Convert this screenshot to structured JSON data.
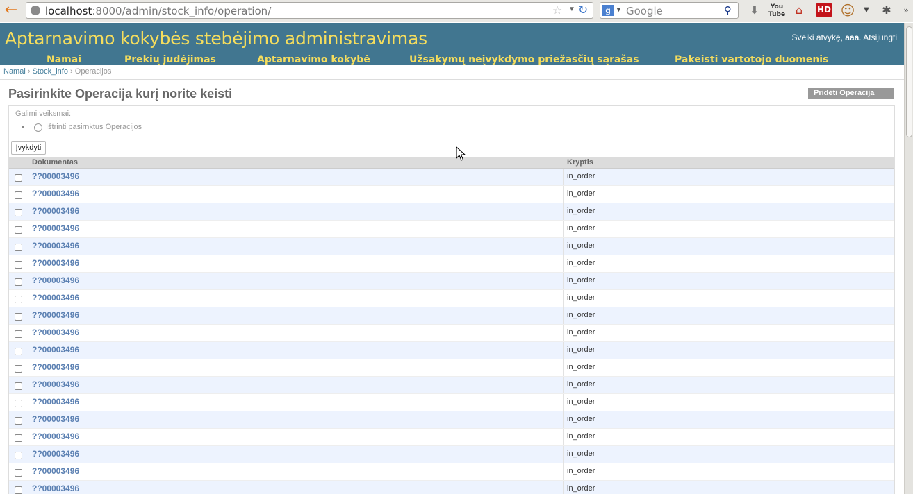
{
  "browser": {
    "url_host": "localhost",
    "url_rest": ":8000/admin/stock_info/operation/",
    "search_placeholder": "Google",
    "hd_label": "HD",
    "youtube_label": "You Tube"
  },
  "header": {
    "site_title": "Aptarnavimo kokybės stebėjimo administravimas",
    "user_greeting": "Sveiki atvykę,",
    "username": "aaa",
    "logout_label": "Atsijungti",
    "nav": [
      {
        "label": "Namai"
      },
      {
        "label": "Prekių judėjimas"
      },
      {
        "label": "Aptarnavimo kokybė"
      },
      {
        "label": "Užsakymų neįvykdymo priežasčių sąrašas"
      },
      {
        "label": "Pakeisti vartotojo duomenis"
      }
    ]
  },
  "breadcrumbs": {
    "home": "Namai",
    "app": "Stock_info",
    "current": "Operacijos",
    "separator": "›"
  },
  "page": {
    "title": "Pasirinkite Operacija kurį norite keisti",
    "add_button": "Pridėti Operacija"
  },
  "actions": {
    "label": "Galimi veiksmai:",
    "option": "Ištrinti pasirnktus Operacijos",
    "go_button": "Įvykdyti"
  },
  "table": {
    "columns": [
      "Dokumentas",
      "Kryptis"
    ],
    "rows": [
      {
        "doc": "??00003496",
        "dir": "in_order"
      },
      {
        "doc": "??00003496",
        "dir": "in_order"
      },
      {
        "doc": "??00003496",
        "dir": "in_order"
      },
      {
        "doc": "??00003496",
        "dir": "in_order"
      },
      {
        "doc": "??00003496",
        "dir": "in_order"
      },
      {
        "doc": "??00003496",
        "dir": "in_order"
      },
      {
        "doc": "??00003496",
        "dir": "in_order"
      },
      {
        "doc": "??00003496",
        "dir": "in_order"
      },
      {
        "doc": "??00003496",
        "dir": "in_order"
      },
      {
        "doc": "??00003496",
        "dir": "in_order"
      },
      {
        "doc": "??00003496",
        "dir": "in_order"
      },
      {
        "doc": "??00003496",
        "dir": "in_order"
      },
      {
        "doc": "??00003496",
        "dir": "in_order"
      },
      {
        "doc": "??00003496",
        "dir": "in_order"
      },
      {
        "doc": "??00003496",
        "dir": "in_order"
      },
      {
        "doc": "??00003496",
        "dir": "in_order"
      },
      {
        "doc": "??00003496",
        "dir": "in_order"
      },
      {
        "doc": "??00003496",
        "dir": "in_order"
      },
      {
        "doc": "??00003496",
        "dir": "in_order"
      }
    ]
  },
  "colors": {
    "header_bg": "#417690",
    "header_text": "#f5dd5d",
    "link": "#5b80b2",
    "row_alt": "#edf3fe"
  }
}
